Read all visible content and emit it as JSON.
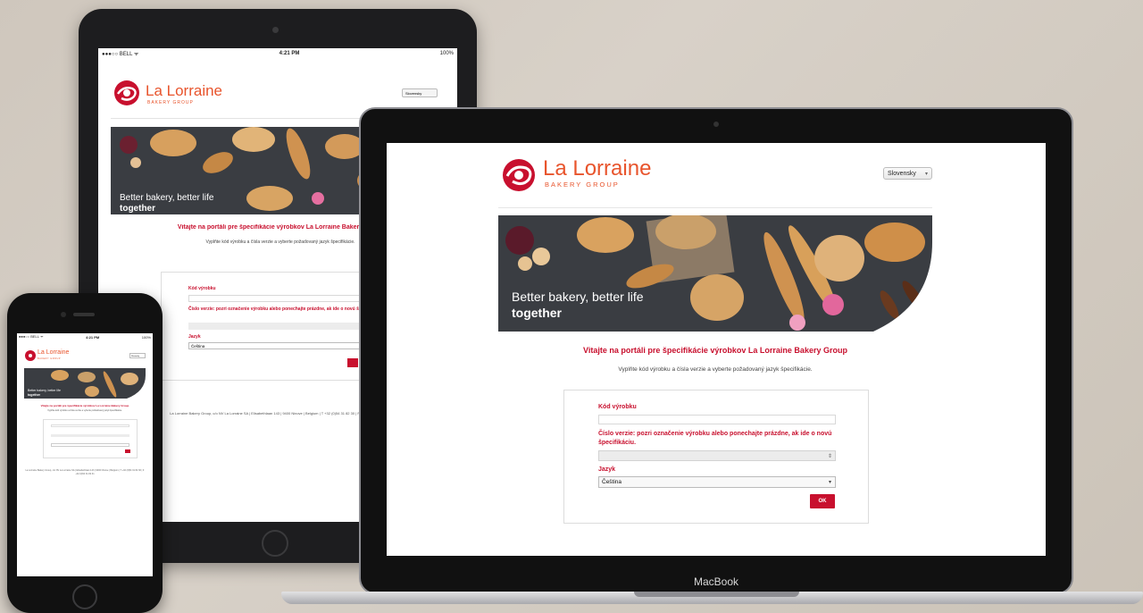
{
  "status_bar": {
    "carrier": "●●●○○ BELL ᯤ",
    "time": "4:21 PM",
    "battery": "100%"
  },
  "logo": {
    "brand_name": "La Lorraine",
    "brand_sub": "BAKERY GROUP"
  },
  "language_select": {
    "selected": "Slovensky"
  },
  "hero": {
    "line1": "Better bakery, better life",
    "line2": "together"
  },
  "page": {
    "title": "Vitajte na portáli pre špecifikácie výrobkov La Lorraine Bakery Group",
    "subtitle": "Vyplňte kód výrobku a čísla verzie a vyberte požadovaný jazyk špecifikácie."
  },
  "form": {
    "product_code_label": "Kód výrobku",
    "version_label": "Číslo verzie: pozri označenie výrobku alebo ponechajte prázdne, ak ide o novú špecifikáciu.",
    "language_label": "Jazyk",
    "language_value": "Čeština",
    "ok_label": "OK"
  },
  "footer": {
    "text": "La Lorraine Bakery Group, c/o NV La Lorraine SA | Elisabethlaan 143 | 9400 Ninove | Belgium | T +32 (0)54 31 82 30 | F +32 (0)54 31 82 31"
  },
  "device": {
    "laptop_brand": "MacBook"
  },
  "colors": {
    "accent": "#c8102e",
    "logo_orange": "#e8542c"
  }
}
